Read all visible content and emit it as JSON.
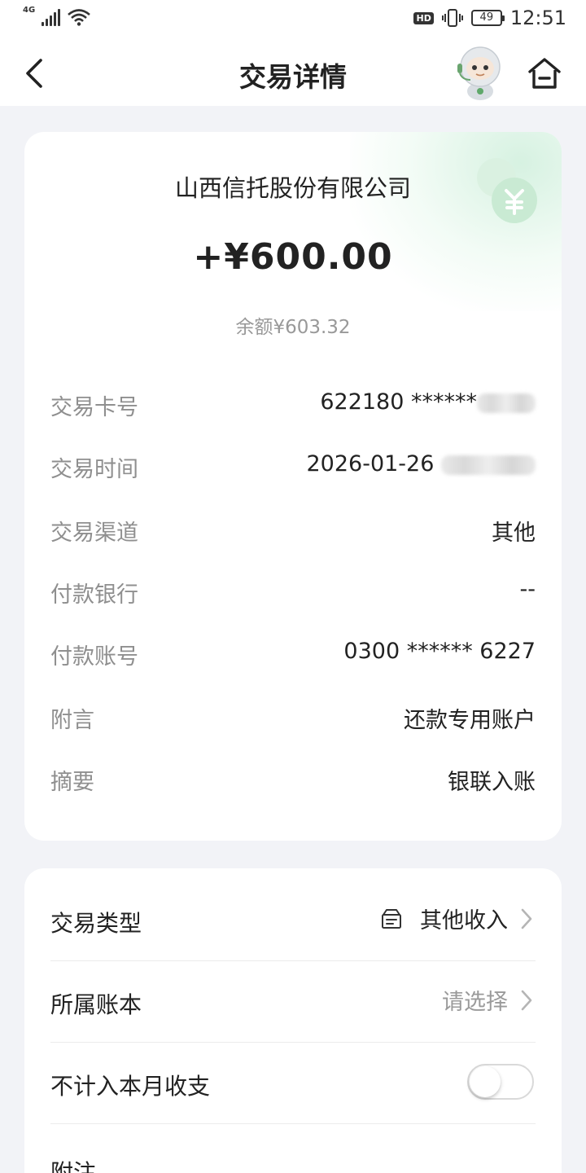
{
  "status_bar": {
    "network": "4G",
    "hd": "HD",
    "battery": "49",
    "time": "12:51"
  },
  "nav": {
    "title": "交易详情",
    "icons": [
      "back-arrow-icon",
      "assistant-mascot-icon",
      "home-icon"
    ]
  },
  "detail": {
    "merchant": "山西信托股份有限公司",
    "amount": "+¥600.00",
    "balance": "余额¥603.32",
    "rows": [
      {
        "label": "交易卡号",
        "value": "622180 ******"
      },
      {
        "label": "交易时间",
        "value": "2026-01-26"
      },
      {
        "label": "交易渠道",
        "value": "其他"
      },
      {
        "label": "付款银行",
        "value": "--"
      },
      {
        "label": "付款账号",
        "value": "0300 ****** 6227"
      },
      {
        "label": "附言",
        "value": "还款专用账户"
      },
      {
        "label": "摘要",
        "value": "银联入账"
      }
    ],
    "accent_color": "#d5f0de"
  },
  "settings": {
    "transaction_type": {
      "label": "交易类型",
      "value": "其他收入",
      "icon": "category-icon"
    },
    "account_book": {
      "label": "所属账本",
      "value": "请选择"
    },
    "exclude_monthly": {
      "label": "不计入本月收支",
      "enabled": false
    },
    "note": {
      "label": "附注"
    }
  }
}
